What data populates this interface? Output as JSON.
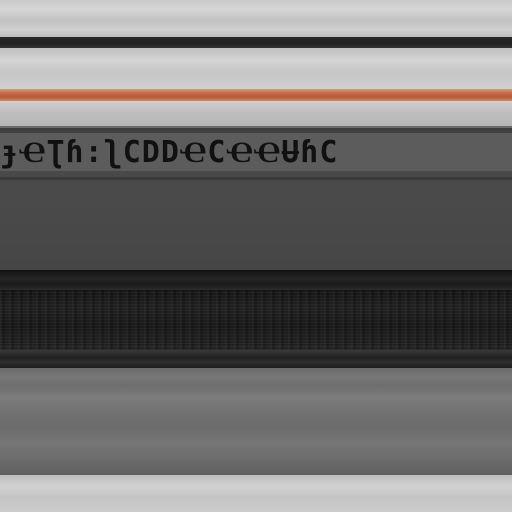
{
  "panel": {
    "glyph_text": "ɟҼƮɦ:ʅϹDDҼϹҼҼɄɦϹ"
  },
  "colors": {
    "accent_stripe": "#c46a45",
    "glyph_panel": "#4a4a4a",
    "glyph_ink": "#111111",
    "dark_stripe": "#1a1a1a",
    "light_metal": "#cccccc"
  }
}
